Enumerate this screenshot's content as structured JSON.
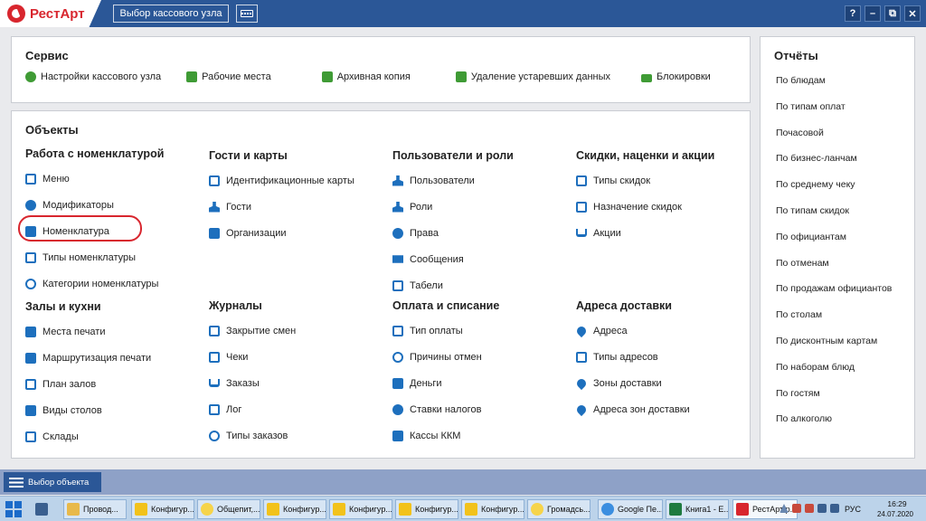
{
  "app": {
    "logo_text": "РестАрт",
    "kassa_button": "Выбор кассового узла",
    "window_buttons": [
      "?",
      "–",
      "⧉",
      "✕"
    ]
  },
  "servis": {
    "title": "Сервис",
    "items": [
      {
        "label": "Настройки кассового узла",
        "icon": "gear-icon"
      },
      {
        "label": "Рабочие места",
        "icon": "workplace-icon"
      },
      {
        "label": "Архивная копия",
        "icon": "archive-icon"
      },
      {
        "label": "Удаление устаревших данных",
        "icon": "trash-icon"
      },
      {
        "label": "Блокировки",
        "icon": "lock-icon"
      }
    ]
  },
  "objects": {
    "title": "Объекты",
    "groups": [
      {
        "title": "Работа с номенклатурой",
        "items": [
          "Меню",
          "Модификаторы",
          "Номенклатура",
          "Типы номенклатуры",
          "Категории номенклатуры"
        ]
      },
      {
        "title": "Залы и кухни",
        "items": [
          "Места печати",
          "Маршрутизация печати",
          "План залов",
          "Виды столов",
          "Склады"
        ]
      },
      {
        "title": "Гости и карты",
        "items": [
          "Идентификационные карты",
          "Гости",
          "Организации"
        ]
      },
      {
        "title": "Журналы",
        "items": [
          "Закрытие смен",
          "Чеки",
          "Заказы",
          "Лог",
          "Типы заказов"
        ]
      },
      {
        "title": "Пользователи и роли",
        "items": [
          "Пользователи",
          "Роли",
          "Права",
          "Сообщения",
          "Табели"
        ]
      },
      {
        "title": "Оплата и списание",
        "items": [
          "Тип оплаты",
          "Причины отмен",
          "Деньги",
          "Ставки налогов",
          "Кассы ККМ"
        ]
      },
      {
        "title": "Скидки, наценки и акции",
        "items": [
          "Типы скидок",
          "Назначение скидок",
          "Акции"
        ]
      },
      {
        "title": "Адреса доставки",
        "items": [
          "Адреса",
          "Типы адресов",
          "Зоны доставки",
          "Адреса зон доставки"
        ]
      }
    ]
  },
  "reports": {
    "title": "Отчёты",
    "items": [
      "По блюдам",
      "По типам оплат",
      "Почасовой",
      "По бизнес-ланчам",
      "По среднему чеку",
      "По типам скидок",
      "По официантам",
      "По отменам",
      "По продажам официантов",
      "По столам",
      "По дисконтным картам",
      "По наборам блюд",
      "По гостям",
      "По алкоголю"
    ]
  },
  "bottom": {
    "object_select": "Выбор объекта"
  },
  "taskbar": {
    "items": [
      "Провод...",
      "Конфигур...",
      "Общепит,...",
      "Конфигур...",
      "Конфигур...",
      "Конфигур...",
      "Конфигур...",
      "Громадсь...",
      "Google Пе...",
      "Книга1 - E...",
      "РестАрт р..."
    ],
    "lang": "РУС",
    "time": "16:29",
    "date": "24.07.2020"
  },
  "colors": {
    "accent": "#2b5797",
    "icon_blue": "#1d6fbd",
    "icon_green": "#3f9b35",
    "highlight": "#d8262e"
  }
}
